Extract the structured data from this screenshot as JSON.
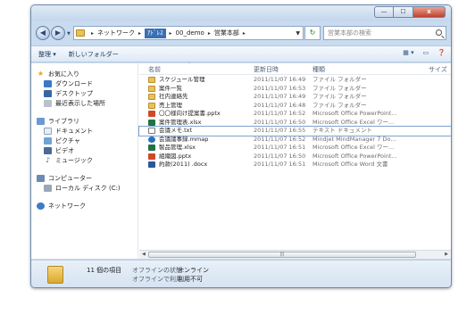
{
  "window": {
    "minimize": "—",
    "maximize": "☐",
    "close": "x"
  },
  "address": {
    "crumbs": [
      "ネットワーク",
      "ｱﾄﾞﾚｽ",
      "00_demo",
      "営業本部"
    ],
    "refresh_icon": "refresh-icon",
    "search_placeholder": "営業本部の検索"
  },
  "toolbar": {
    "organize": "整理 ▾",
    "new_folder": "新しいフォルダー"
  },
  "sidebar": {
    "favorites": {
      "label": "お気に入り",
      "items": [
        "ダウンロード",
        "デスクトップ",
        "最近表示した場所"
      ]
    },
    "libraries": {
      "label": "ライブラリ",
      "items": [
        "ドキュメント",
        "ピクチャ",
        "ビデオ",
        "ミュージック"
      ]
    },
    "computer": {
      "label": "コンピューター",
      "items": [
        "ローカル ディスク (C:)"
      ]
    },
    "network": {
      "label": "ネットワーク"
    }
  },
  "columns": {
    "name": "名前",
    "date": "更新日時",
    "type": "種類",
    "size": "サイズ"
  },
  "files": [
    {
      "icon": "folder",
      "name": "スケジュール管理",
      "date": "2011/11/07 16:49",
      "type": "ファイル フォルダー"
    },
    {
      "icon": "folder",
      "name": "案件一覧",
      "date": "2011/11/07 16:53",
      "type": "ファイル フォルダー"
    },
    {
      "icon": "folder",
      "name": "社内連絡先",
      "date": "2011/11/07 16:49",
      "type": "ファイル フォルダー"
    },
    {
      "icon": "folder",
      "name": "売上管理",
      "date": "2011/11/07 16:48",
      "type": "ファイル フォルダー"
    },
    {
      "icon": "ppt",
      "name": "〇〇様向け提案書.pptx",
      "date": "2011/11/07 16:52",
      "type": "Microsoft Office PowerPoint..."
    },
    {
      "icon": "xls",
      "name": "案件管理表.xlsx",
      "date": "2011/11/07 16:50",
      "type": "Microsoft Office Excel ワー..."
    },
    {
      "icon": "txt",
      "name": "会議メモ.txt",
      "date": "2011/11/07 16:55",
      "type": "テキスト ドキュメント"
    },
    {
      "icon": "mm",
      "name": "会議議事録.mmap",
      "date": "2011/11/07 16:52",
      "type": "Mindjet MindManager 7 Do..."
    },
    {
      "icon": "xls",
      "name": "製品管理.xlsx",
      "date": "2011/11/07 16:51",
      "type": "Microsoft Office Excel ワー..."
    },
    {
      "icon": "ppt",
      "name": "組織図.pptx",
      "date": "2011/11/07 16:50",
      "type": "Microsoft Office PowerPoint..."
    },
    {
      "icon": "doc",
      "name": "約款(2011) .docx",
      "date": "2011/11/07 16:51",
      "type": "Microsoft Office Word 文書"
    }
  ],
  "scrollbar": {
    "thumb_grip": "|||"
  },
  "details": {
    "count": "11 個の項目",
    "offline_status_label": "オフラインの状態:",
    "offline_status_value": "オンライン",
    "offline_avail_label": "オフラインで利用...",
    "offline_avail_value": "利用不可"
  }
}
